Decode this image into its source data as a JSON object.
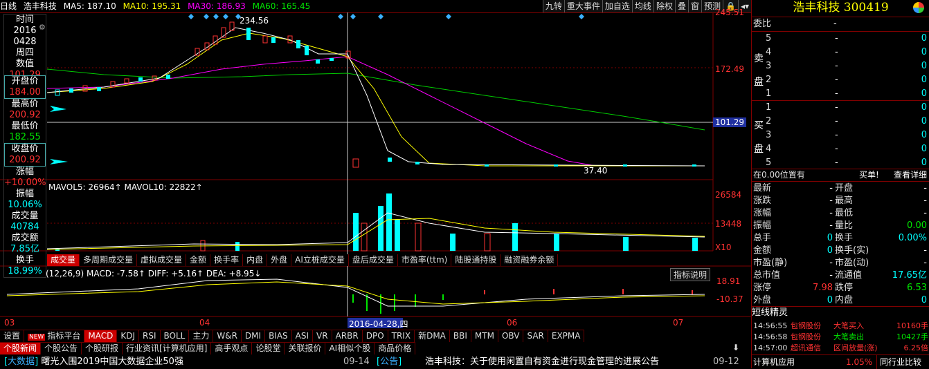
{
  "header": {
    "period": "日线",
    "stock": "浩丰科技",
    "ma5": "MA5: 187.10",
    "ma10": "MA10: 195.31",
    "ma30": "MA30: 186.93",
    "ma60": "MA60: 165.45"
  },
  "toolbar": [
    "九转",
    "重大事件",
    "加自选",
    "均线",
    "除权",
    "叠",
    "窗",
    "预测",
    "🔒"
  ],
  "title": "浩丰科技 300419",
  "crosshair_info": {
    "time_label": "时间",
    "year": "2016",
    "mmdd": "0428",
    "weekday": "周四",
    "value_label": "数值",
    "value": "101.29",
    "open_label": "开盘价",
    "open": "184.00",
    "high_label": "最高价",
    "high": "200.92",
    "low_label": "最低价",
    "low": "182.55",
    "close_label": "收盘价",
    "close": "200.92",
    "chg_label": "涨幅",
    "chg": "+10.00%",
    "amp_label": "振幅",
    "amp": "10.06%",
    "vol_label": "成交量",
    "vol": "40784",
    "amt_label": "成交额",
    "amt": "7.85亿",
    "turn_label": "换手",
    "turn": "18.99%"
  },
  "price_axis": {
    "top": "245.51",
    "mid": "172.49",
    "cross": "101.29",
    "peak": "234.56",
    "trough": "37.40"
  },
  "volume": {
    "label": "MAVOL5: 26964↑  MAVOL10: 22822↑",
    "axis_top": "26584",
    "axis_mid": "13448",
    "unit": "X10"
  },
  "vol_tabs": [
    "成交量",
    "多周期成交量",
    "虚拟成交量",
    "金额",
    "换手率",
    "内盘",
    "外盘",
    "AI立桩成交量",
    "盘后成交量",
    "市盈率(ttm)",
    "陆股通持股",
    "融资融券余额"
  ],
  "macd": {
    "label": "(12,26,9)  MACD: -7.58↑  DIFF: +5.16↑  DEA: +8.95↓",
    "top": "18.91",
    "bot": "-10.37",
    "explain": "指标说明"
  },
  "dates": {
    "m03": "03",
    "m04": "04",
    "sel": "2016-04-28,四",
    "m06": "06",
    "m07": "07"
  },
  "ind_tabs": [
    "设置",
    "指标平台",
    "MACD",
    "KDJ",
    "RSI",
    "BOLL",
    "主力",
    "W&R",
    "DMI",
    "BIAS",
    "ASI",
    "VR",
    "ARBR",
    "DPO",
    "TRIX",
    "新DMA",
    "BBI",
    "MTM",
    "OBV",
    "SAR",
    "EXPMA"
  ],
  "new_badge": "NEW",
  "news_tabs": [
    "个股新闻",
    "个股公告",
    "个股研报",
    "行业资讯[计算机应用]",
    "高手观点",
    "论股堂",
    "关联报价",
    "AI相似个股",
    "商品价格"
  ],
  "ticker": {
    "tag1": "大数据",
    "text1": "曙光入围2019中国大数据企业50强",
    "date1": "09-14",
    "tag2": "公告",
    "text2": "浩丰科技：关于使用闲置自有资金进行现金管理的进展公告",
    "date2": "09-12"
  },
  "order": {
    "weibi": "委比",
    "dash": "-",
    "zero": "0",
    "sell_label": "卖盘",
    "buy_label": "买盘",
    "levels": [
      "5",
      "4",
      "3",
      "2",
      "1"
    ],
    "note": "在0.00位置有",
    "buy1": "买单!",
    "detail": "查看详细"
  },
  "quote_left": [
    [
      "最新",
      "-"
    ],
    [
      "涨跌",
      "-"
    ],
    [
      "涨幅",
      "-"
    ],
    [
      "振幅",
      "-"
    ],
    [
      "总手",
      "0"
    ],
    [
      "金额",
      "0"
    ],
    [
      "市盈(静)",
      "-"
    ],
    [
      "总市值",
      "-"
    ],
    [
      "涨停",
      "7.98"
    ],
    [
      "外盘",
      "0"
    ]
  ],
  "quote_right": [
    [
      "开盘",
      "-"
    ],
    [
      "最高",
      "-"
    ],
    [
      "最低",
      "-"
    ],
    [
      "量比",
      "0.00"
    ],
    [
      "换手",
      "0.00%"
    ],
    [
      "换手(实)",
      "-"
    ],
    [
      "市盈(动)",
      "-"
    ],
    [
      "流通值",
      "17.65亿"
    ],
    [
      "跌停",
      "6.53"
    ],
    [
      "内盘",
      "0"
    ]
  ],
  "shortline": {
    "title": "短线精灵",
    "rows": [
      [
        "14:56:55",
        "包钢股份",
        "大笔买入",
        "10160手"
      ],
      [
        "14:56:58",
        "包钢股份",
        "大笔卖出",
        "10427手"
      ],
      [
        "14:57:00",
        "超讯通信",
        "区间放量(涨)",
        "6.25倍"
      ]
    ]
  },
  "footer": {
    "sector": "计算机应用",
    "pct": "1.05%",
    "compare": "同行业比较"
  },
  "colors": {
    "up": "#ff3232",
    "down": "#00ffff",
    "ma5": "#ffffff",
    "ma10": "#ffff00",
    "ma30": "#ff00ff",
    "ma60": "#00cc00"
  }
}
